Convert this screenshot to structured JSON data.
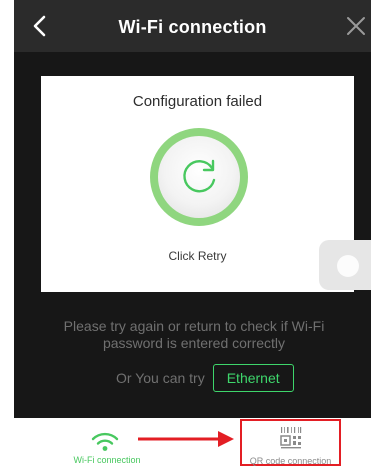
{
  "header": {
    "title": "Wi-Fi connection",
    "back_icon": "chevron-left-icon",
    "close_icon": "close-icon"
  },
  "card": {
    "title": "Configuration failed",
    "retry_icon": "refresh-icon",
    "retry_label": "Click Retry"
  },
  "message": "Please try again or return to check if Wi-Fi password is entered correctly",
  "alternative": {
    "prefix": "Or You can try",
    "ethernet_label": "Ethernet"
  },
  "bottom_tabs": [
    {
      "label": "Wi-Fi connection",
      "icon": "wifi-icon",
      "active": true
    },
    {
      "label": "QR code connection",
      "icon": "qr-code-icon",
      "highlighted": true
    }
  ],
  "colors": {
    "accent_green": "#3ed66b",
    "ring_green": "#8fd67f",
    "highlight_red": "#e31e24",
    "header_bg": "#2b2b2b",
    "screen_bg": "#171717"
  }
}
